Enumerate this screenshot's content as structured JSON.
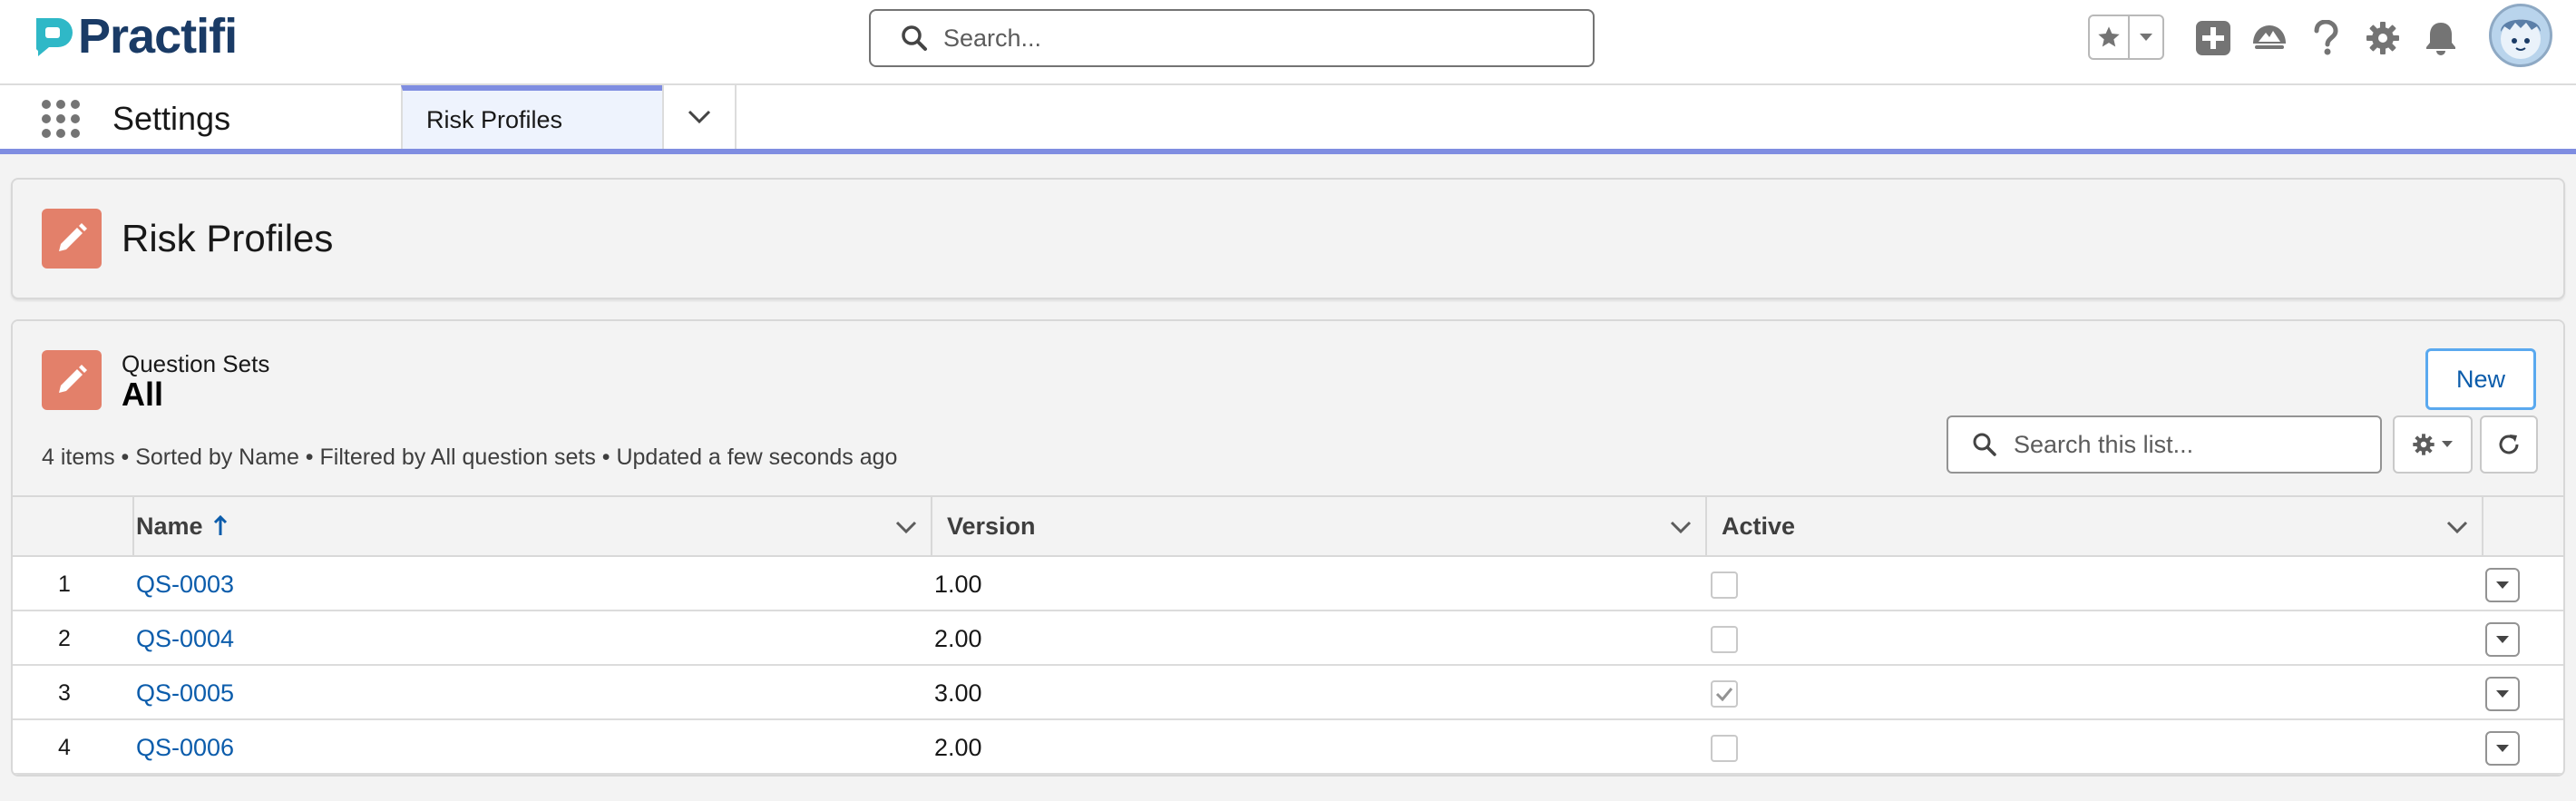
{
  "brand": {
    "name": "Practifi"
  },
  "global_search": {
    "placeholder": "Search..."
  },
  "header_icons": [
    "favorites-star-icon",
    "favorites-dropdown-icon",
    "add-icon",
    "trailhead-icon",
    "help-icon",
    "setup-gear-icon",
    "notifications-bell-icon",
    "user-avatar"
  ],
  "context_bar": {
    "app_name": "Settings",
    "tabs": [
      {
        "label": "Risk Profiles",
        "active": true
      }
    ]
  },
  "page_header": {
    "title": "Risk Profiles",
    "icon": "edit-pencil-icon",
    "icon_color": "#e3806a"
  },
  "list_view": {
    "object_label": "Question Sets",
    "view_name": "All",
    "meta": "4 items • Sorted by Name • Filtered by All question sets • Updated a few seconds ago",
    "new_button": "New",
    "search_placeholder": "Search this list...",
    "columns": [
      {
        "label": "Name",
        "sorted": "ascending"
      },
      {
        "label": "Version"
      },
      {
        "label": "Active"
      }
    ],
    "rows": [
      {
        "num": "1",
        "name": "QS-0003",
        "version": "1.00",
        "active": false
      },
      {
        "num": "2",
        "name": "QS-0004",
        "version": "2.00",
        "active": false
      },
      {
        "num": "3",
        "name": "QS-0005",
        "version": "3.00",
        "active": true
      },
      {
        "num": "4",
        "name": "QS-0006",
        "version": "2.00",
        "active": false
      }
    ]
  },
  "colors": {
    "accent": "#7f8de1",
    "link": "#0b5cab",
    "brand_teal": "#2fb8c7",
    "brand_navy": "#1a3b66",
    "object_icon": "#e3806a"
  }
}
